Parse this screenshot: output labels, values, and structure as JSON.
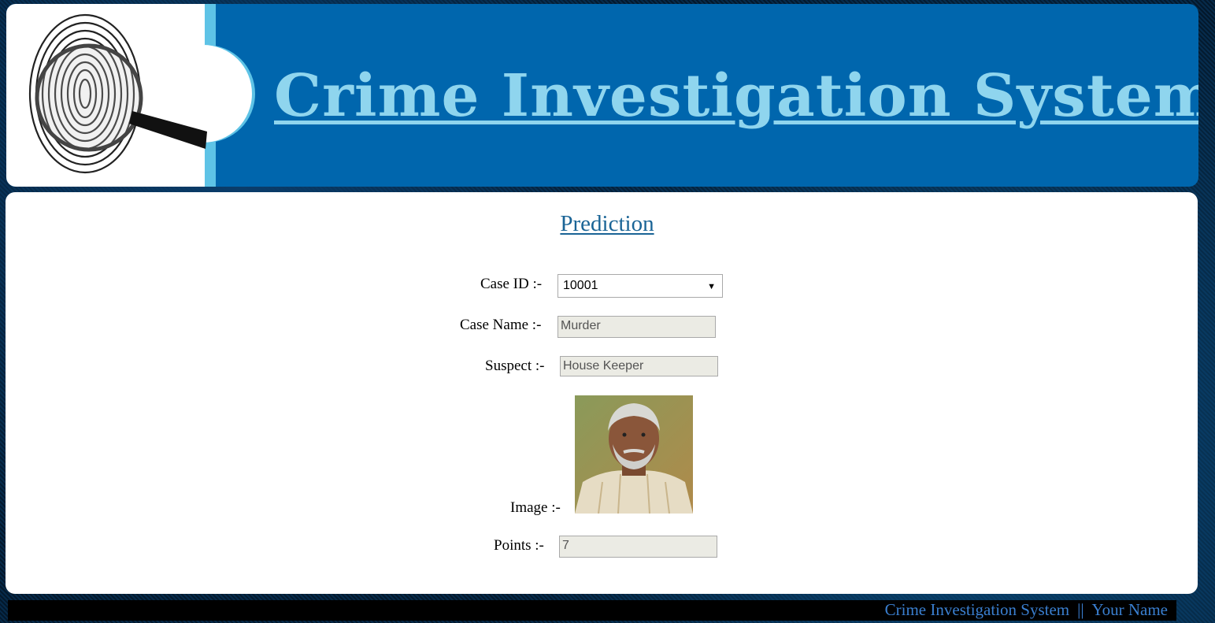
{
  "header": {
    "title": "Crime Investigation System",
    "logo_icon": "fingerprint-magnifier-icon"
  },
  "form": {
    "title": "Prediction",
    "case_id_label": "Case ID :-",
    "case_id_value": "10001",
    "case_name_label": "Case Name :-",
    "case_name_value": "Murder",
    "suspect_label": "Suspect :-",
    "suspect_value": "House Keeper",
    "image_label": "Image :-",
    "points_label": "Points :-",
    "points_value": "7"
  },
  "footer": {
    "app_name": "Crime Investigation System",
    "separator": "||",
    "author": "Your Name"
  },
  "colors": {
    "banner_bg": "#0066ad",
    "banner_title": "#8fd5ee",
    "page_title": "#1a6496",
    "footer_text": "#3a7fd0"
  }
}
